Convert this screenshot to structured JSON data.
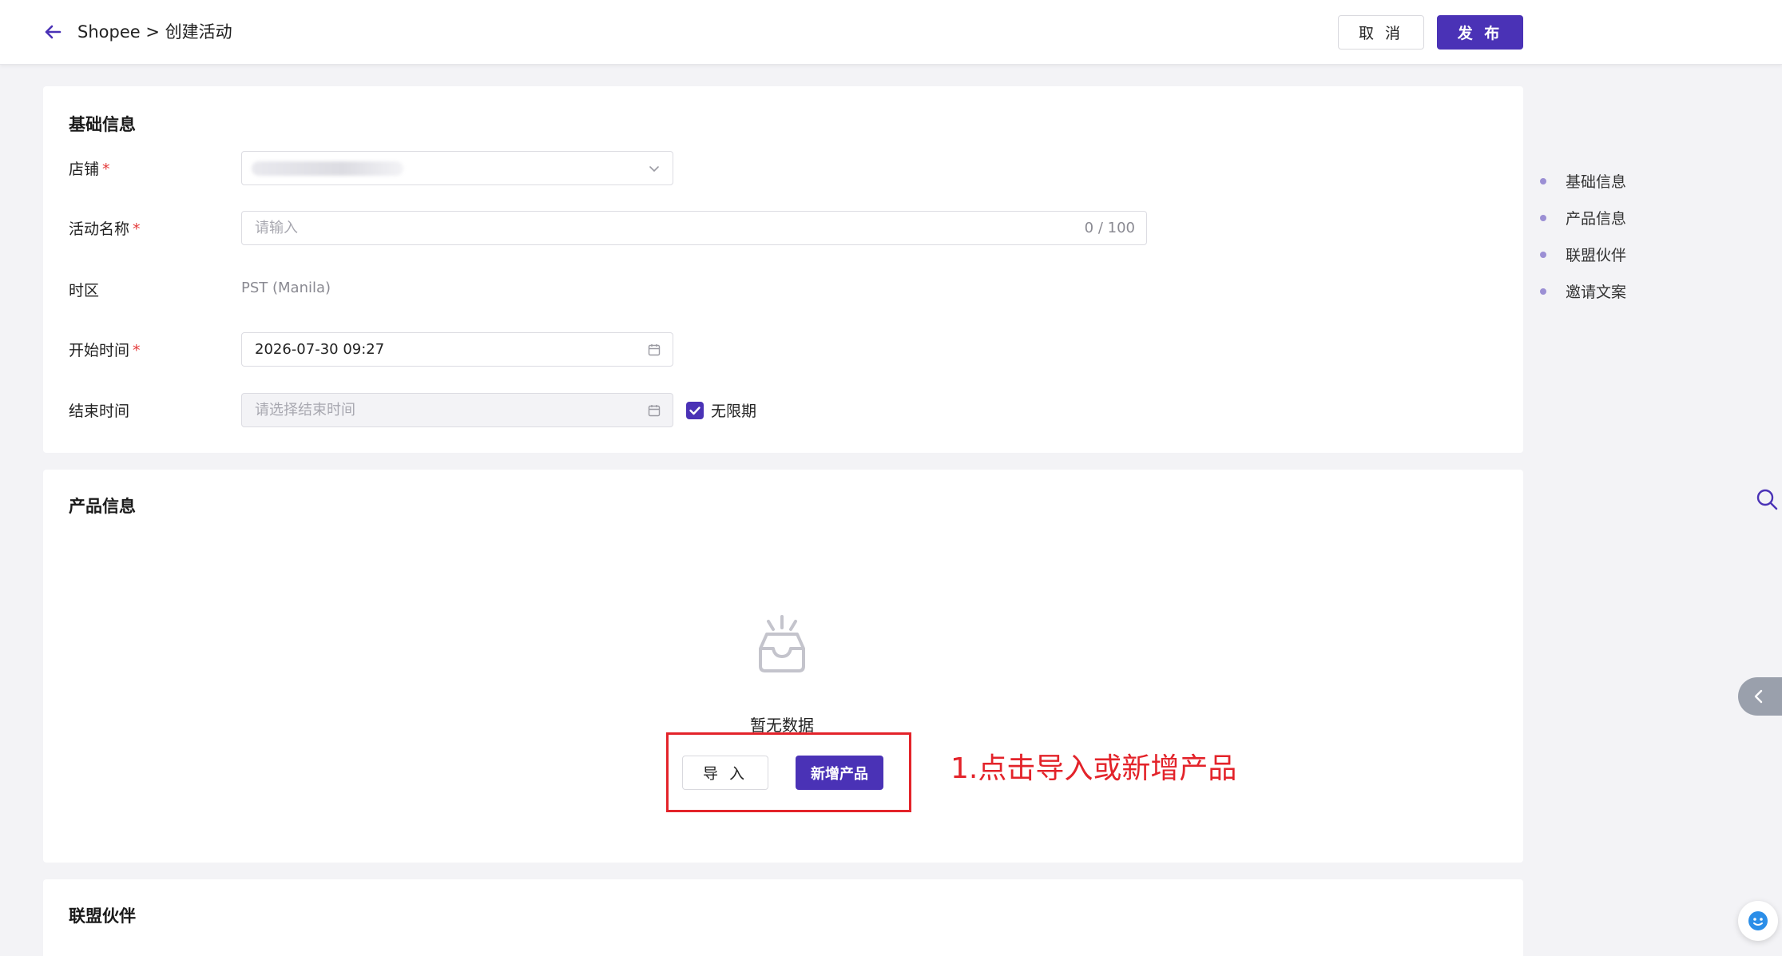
{
  "header": {
    "breadcrumb": "Shopee > 创建活动",
    "cancel_label": "取 消",
    "publish_label": "发 布"
  },
  "basic_info": {
    "title": "基础信息",
    "shop_label": "店铺",
    "activity_name_label": "活动名称",
    "activity_name_placeholder": "请输入",
    "activity_name_counter": "0 / 100",
    "timezone_label": "时区",
    "timezone_value": "PST (Manila)",
    "start_time_label": "开始时间",
    "start_time_value": "2026-07-30 09:27",
    "end_time_label": "结束时间",
    "end_time_placeholder": "请选择结束时间",
    "unlimited_label": "无限期",
    "required_mark": "*"
  },
  "product_info": {
    "title": "产品信息",
    "empty_text": "暂无数据",
    "import_label": "导 入",
    "add_label": "新增产品",
    "annotation": "1.点击导入或新增产品"
  },
  "partners": {
    "title": "联盟伙伴"
  },
  "anchor_nav": {
    "items": [
      {
        "label": "基础信息"
      },
      {
        "label": "产品信息"
      },
      {
        "label": "联盟伙伴"
      },
      {
        "label": "邀请文案"
      }
    ]
  },
  "colors": {
    "primary": "#4a32b6",
    "annotation": "#e3232a",
    "required": "#e43b3b"
  }
}
